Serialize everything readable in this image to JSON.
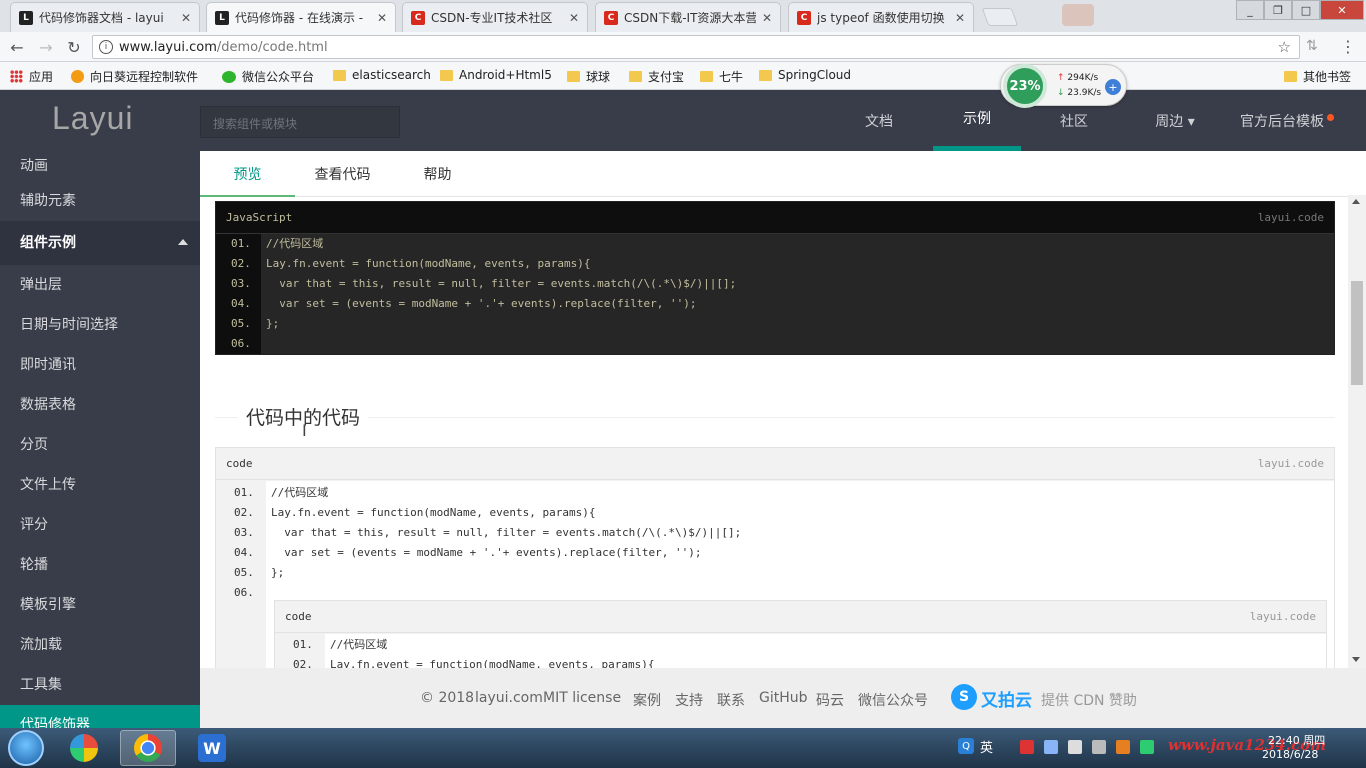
{
  "browser": {
    "tabs": [
      {
        "title": "代码修饰器文档 - layui",
        "favicon": "layui-icon",
        "active": false
      },
      {
        "title": "代码修饰器 - 在线演示 -",
        "favicon": "layui-icon",
        "active": true
      },
      {
        "title": "CSDN-专业IT技术社区",
        "favicon": "csdn-icon",
        "active": false
      },
      {
        "title": "CSDN下载-IT资源大本营",
        "favicon": "csdn-icon",
        "active": false
      },
      {
        "title": "js typeof 函数使用切换",
        "favicon": "csdn-icon",
        "active": false
      }
    ],
    "tab_close_glyph": "✕",
    "url_host": "www.layui.com",
    "url_path": "/demo/code.html",
    "bookmarks": [
      {
        "label": "应用",
        "icon": "apps-icon"
      },
      {
        "label": "向日葵远程控制软件",
        "icon": "sunflower-icon"
      },
      {
        "label": "微信公众平台",
        "icon": "wechat-icon"
      },
      {
        "label": "elasticsearch",
        "icon": "folder-icon"
      },
      {
        "label": "Android+Html5",
        "icon": "folder-icon"
      },
      {
        "label": "球球",
        "icon": "folder-icon"
      },
      {
        "label": "支付宝",
        "icon": "folder-icon"
      },
      {
        "label": "七牛",
        "icon": "folder-icon"
      },
      {
        "label": "SpringCloud",
        "icon": "folder-icon"
      }
    ],
    "other_bookmarks": "其他书签",
    "net_monitor": {
      "percent": "23%",
      "up": "294K/s",
      "down": "23.9K/s"
    }
  },
  "site": {
    "logo": "Layui",
    "search_placeholder": "搜索组件或模块",
    "nav": [
      {
        "label": "文档",
        "active": false
      },
      {
        "label": "示例",
        "active": true
      },
      {
        "label": "社区",
        "active": false
      },
      {
        "label": "周边 ▾",
        "active": false
      },
      {
        "label": "官方后台模板",
        "active": false
      }
    ],
    "accent": "#009688"
  },
  "sidebar": {
    "items": [
      {
        "label": "动画",
        "kind": "item"
      },
      {
        "label": "辅助元素",
        "kind": "item"
      },
      {
        "label": "组件示例",
        "kind": "group"
      },
      {
        "label": "弹出层",
        "kind": "item"
      },
      {
        "label": "日期与时间选择",
        "kind": "item"
      },
      {
        "label": "即时通讯",
        "kind": "item"
      },
      {
        "label": "数据表格",
        "kind": "item"
      },
      {
        "label": "分页",
        "kind": "item"
      },
      {
        "label": "文件上传",
        "kind": "item"
      },
      {
        "label": "评分",
        "kind": "item"
      },
      {
        "label": "轮播",
        "kind": "item"
      },
      {
        "label": "模板引擎",
        "kind": "item"
      },
      {
        "label": "流加载",
        "kind": "item"
      },
      {
        "label": "工具集",
        "kind": "item"
      },
      {
        "label": "代码修饰器",
        "kind": "active"
      }
    ]
  },
  "main": {
    "tabs": [
      {
        "label": "预览",
        "active": true
      },
      {
        "label": "查看代码",
        "active": false
      },
      {
        "label": "帮助",
        "active": false
      }
    ],
    "code_dark": {
      "title": "JavaScript",
      "brand": "layui.code",
      "lines": [
        {
          "num": "01.",
          "text": "//代码区域"
        },
        {
          "num": "02.",
          "text": "Lay.fn.event = function(modName, events, params){"
        },
        {
          "num": "03.",
          "text": "  var that = this, result = null, filter = events.match(/\\(.*\\)$/)||[];"
        },
        {
          "num": "04.",
          "text": "  var set = (events = modName + '.'+ events).replace(filter, '');"
        },
        {
          "num": "05.",
          "text": "};"
        },
        {
          "num": "06.",
          "text": ""
        }
      ]
    },
    "section_title": "代码中的代码",
    "code_outer": {
      "title": "code",
      "brand": "layui.code",
      "lines": [
        {
          "num": "01.",
          "text": "//代码区域"
        },
        {
          "num": "02.",
          "text": "Lay.fn.event = function(modName, events, params){"
        },
        {
          "num": "03.",
          "text": "  var that = this, result = null, filter = events.match(/\\(.*\\)$/)||[];"
        },
        {
          "num": "04.",
          "text": "  var set = (events = modName + '.'+ events).replace(filter, '');"
        },
        {
          "num": "05.",
          "text": "};"
        },
        {
          "num": "06.",
          "text": ""
        }
      ]
    },
    "code_inner": {
      "title": "code",
      "brand": "layui.code",
      "lines": [
        {
          "num": "01.",
          "text": "//代码区域"
        },
        {
          "num": "02.",
          "text": "Lay.fn.event = function(modName, events, params){"
        }
      ]
    }
  },
  "footer": {
    "copyright": "© 2018",
    "site": "layui.com",
    "license": "MIT license",
    "links": [
      "案例",
      "支持",
      "联系",
      "GitHub",
      "码云",
      "微信公众号"
    ],
    "sponsor_name": "又拍云",
    "sponsor_text": "提供 CDN 赞助"
  },
  "taskbar": {
    "lang": "英",
    "watermark": "www.java1234.com",
    "time": "22:40 周四",
    "date": "2018/6/28"
  }
}
